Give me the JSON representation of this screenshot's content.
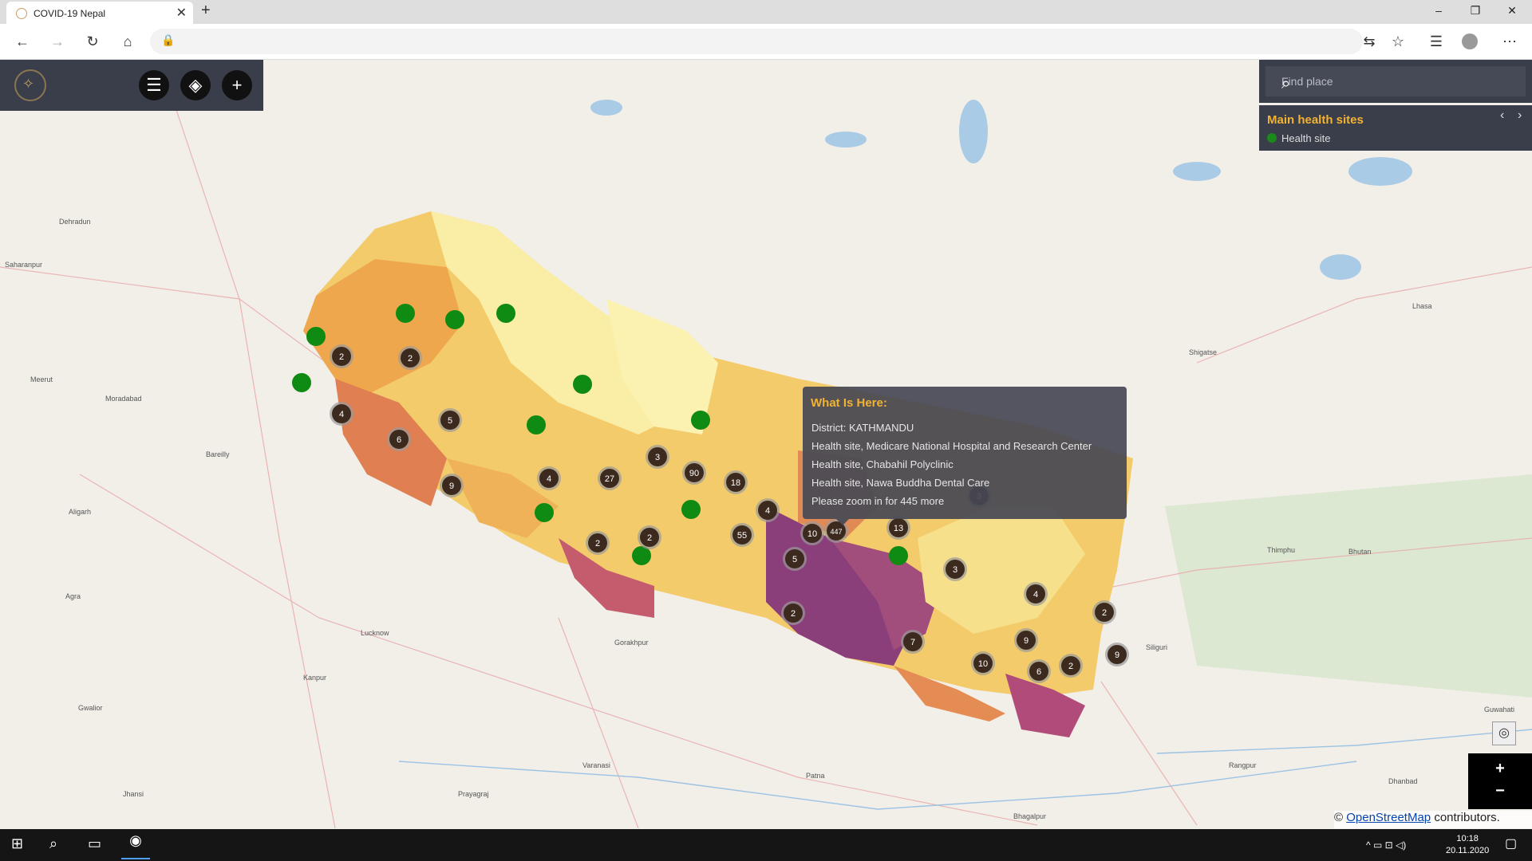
{
  "browser": {
    "tab_title": "COVID-19 Nepal",
    "tab_close": "✕",
    "new_tab": "+",
    "window_controls": [
      "–",
      "❐",
      "✕"
    ]
  },
  "toolbar": {
    "back": "←",
    "forward": "→",
    "refresh": "↻",
    "home": "⌂",
    "lock": "🔒",
    "translate": "⇆",
    "favorite": "☆",
    "collections": "☰",
    "more": "⋯"
  },
  "map_controls": {
    "menu_icon": "☰",
    "layers_icon": "◈",
    "add_icon": "+",
    "search_placeholder": "Find place",
    "search_icon": "⌕",
    "locate_icon": "◎",
    "zoom_in": "+",
    "zoom_out": "−"
  },
  "legend": {
    "title": "Main health sites",
    "item": "Health site",
    "prev": "‹",
    "next": "›"
  },
  "popup": {
    "heading": "What Is Here:",
    "lines": [
      "District: KATHMANDU",
      "Health site, Medicare National Hospital and Research Center",
      "Health site, Chabahil Polyclinic",
      "Health site, Nawa Buddha Dental Care",
      "Please zoom in for 445 more"
    ]
  },
  "attribution": {
    "prefix": "©",
    "link": "OpenStreetMap",
    "suffix": "contributors."
  },
  "clusters": [
    "2",
    "2",
    "4",
    "6",
    "5",
    "9",
    "4",
    "27",
    "3",
    "90",
    "18",
    "4",
    "2",
    "2",
    "55",
    "10",
    "447",
    "5",
    "13",
    "3",
    "3",
    "4",
    "2",
    "2",
    "7",
    "9",
    "10",
    "6",
    "2",
    "9"
  ],
  "map_labels": [
    "Dehradun",
    "Saharanpur",
    "Meerut",
    "Moradabad",
    "Bareilly",
    "Aligarh",
    "Agra",
    "Lucknow",
    "Kanpur",
    "Gorakhpur",
    "Siliguri",
    "Thimphu",
    "Bhutan",
    "Lhasa",
    "Shigatse",
    "Patna",
    "Bhagalpur",
    "Guwahati",
    "Rangpur",
    "Dhanbad",
    "Gwalior",
    "Jhansi",
    "Prayagraj",
    "Varanasi"
  ],
  "taskbar": {
    "start": "⊞",
    "search": "⌕",
    "taskview": "▭",
    "time": "10:18",
    "date": "20.11.2020",
    "tray": "^ ▭ ⊡ ◁)",
    "notify": "▢"
  }
}
